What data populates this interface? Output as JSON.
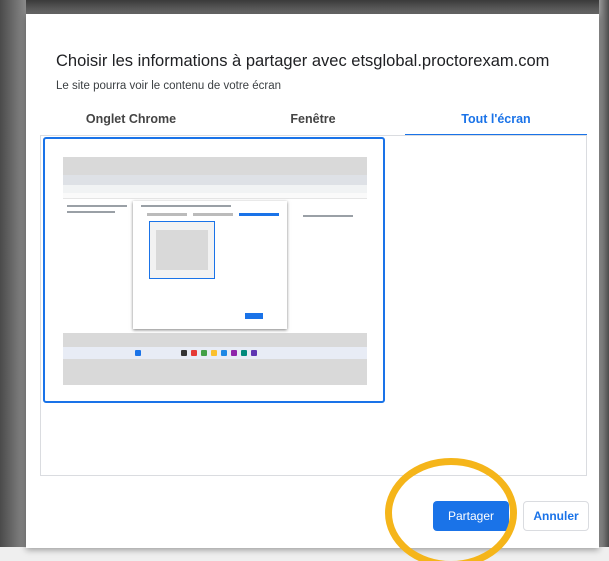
{
  "dialog": {
    "title": "Choisir les informations à partager avec etsglobal.proctorexam.com",
    "subtitle": "Le site pourra voir le contenu de votre écran"
  },
  "tabs": [
    {
      "label": "Onglet Chrome",
      "active": false
    },
    {
      "label": "Fenêtre",
      "active": false
    },
    {
      "label": "Tout l'écran",
      "active": true
    }
  ],
  "buttons": {
    "share_label": "Partager",
    "cancel_label": "Annuler"
  },
  "colors": {
    "accent": "#1a73e8",
    "highlight": "#f5b51a"
  },
  "icons": {
    "screen_preview": "screen-thumbnail-icon"
  }
}
